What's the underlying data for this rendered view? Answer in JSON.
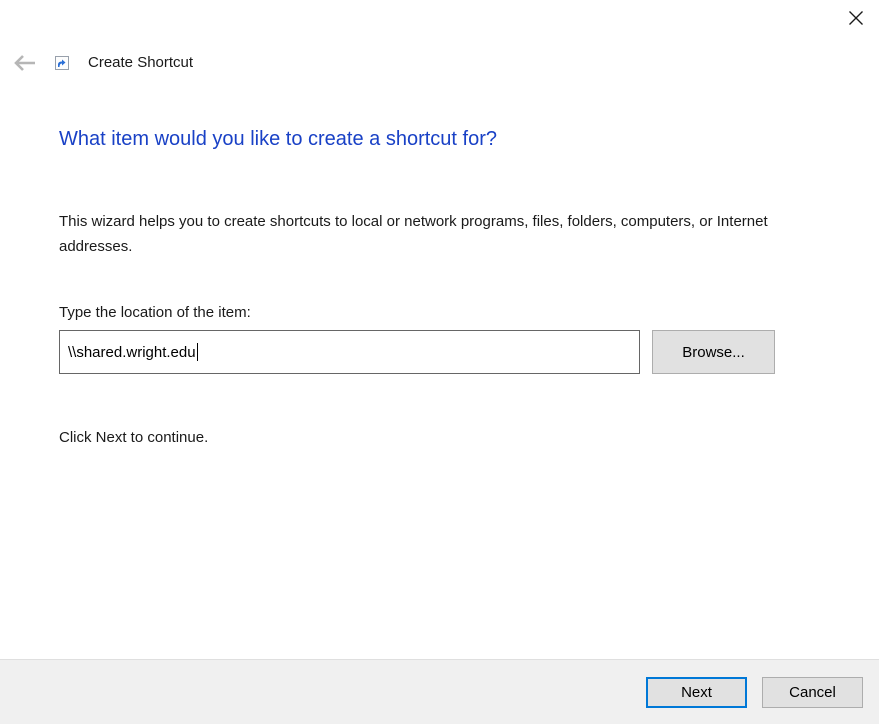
{
  "window": {
    "title": "Create Shortcut"
  },
  "icons": {
    "close": "close-x",
    "back": "left-arrow",
    "app": "shortcut-overlay-arrow"
  },
  "main": {
    "heading": "What item would you like to create a shortcut for?",
    "description": "This wizard helps you to create shortcuts to local or network programs, files, folders, computers, or Internet addresses.",
    "location_label": "Type the location of the item:",
    "location_value": "\\\\shared.wright.edu",
    "browse_label": "Browse...",
    "hint": "Click Next to continue."
  },
  "footer": {
    "next_label": "Next",
    "cancel_label": "Cancel"
  },
  "colors": {
    "heading_blue": "#1941c6",
    "focus_border": "#0078d7",
    "button_face": "#e1e1e1",
    "button_border": "#adadad",
    "footer_bg": "#f0f0f0",
    "input_border": "#666666"
  }
}
